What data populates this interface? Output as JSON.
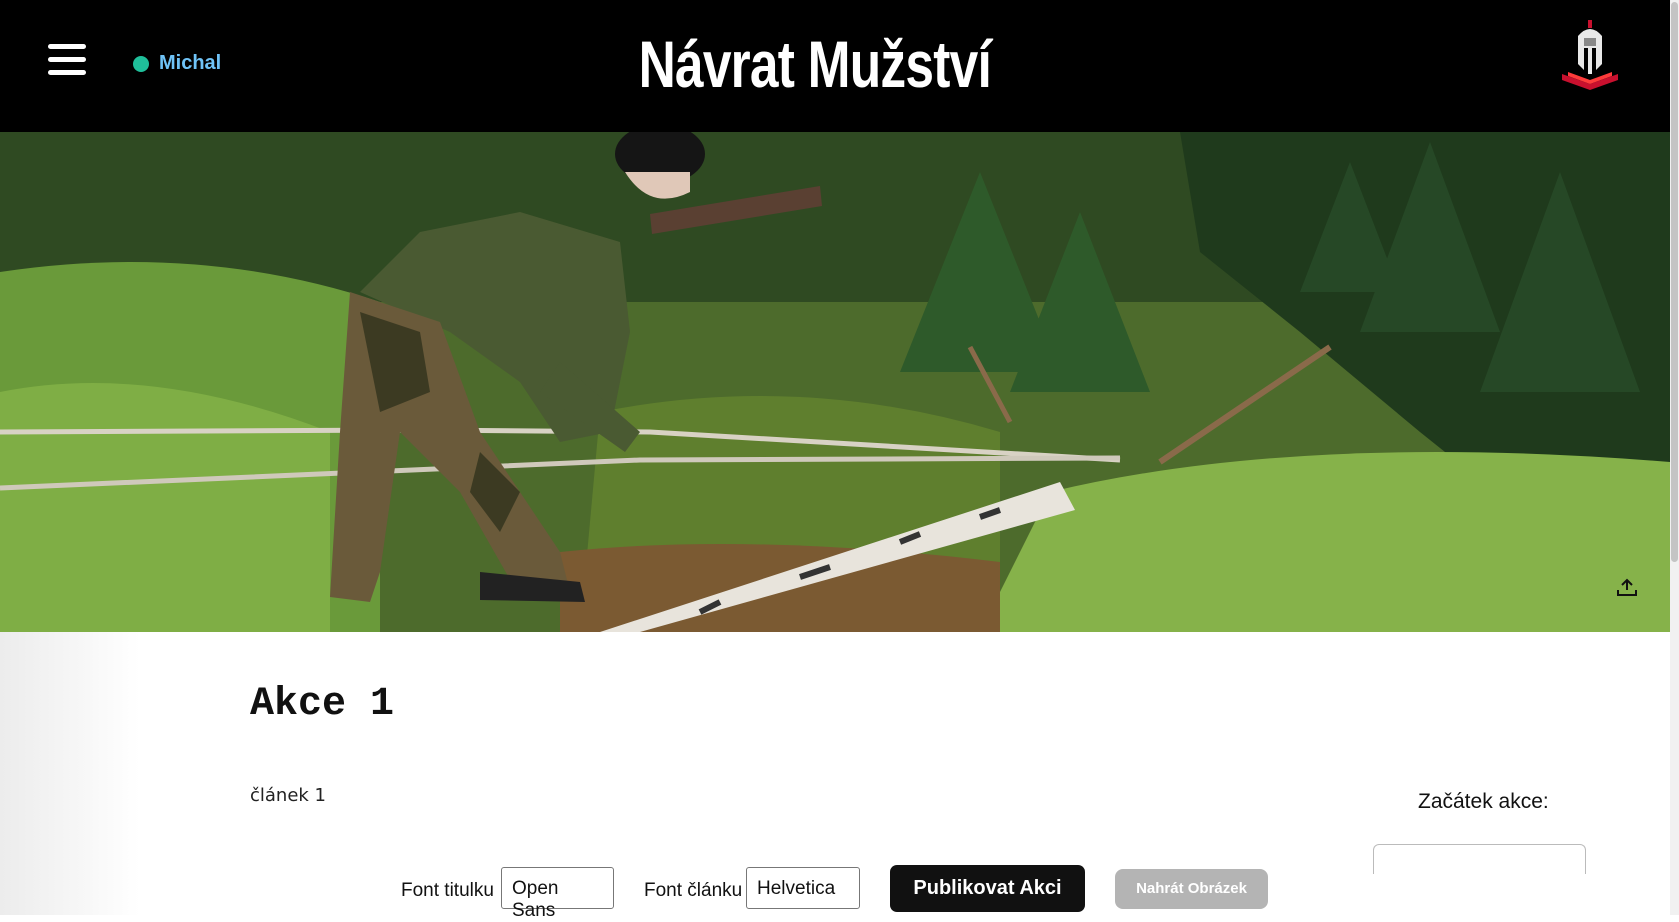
{
  "header": {
    "menu_icon": "hamburger-menu-icon",
    "user_name": "Michal",
    "status_color": "#1fbf9a",
    "site_title": "Návrat Mužství",
    "logo_icon": "spartan-helmet-logo"
  },
  "hero": {
    "image_subject": "man crossing rope bridge over birch log in forest",
    "upload_icon": "upload-icon"
  },
  "article": {
    "title": "Akce 1",
    "body": "článek 1"
  },
  "sidebar": {
    "start_label": "Začátek akce:"
  },
  "toolbar": {
    "title_font_label": "Font titulku",
    "title_font_value": "Open Sans",
    "article_font_label": "Font článku",
    "article_font_value": "Helvetica",
    "publish_label": "Publikovat Akci",
    "upload_label": "Nahrát Obrázek"
  },
  "colors": {
    "header_bg": "#000000",
    "user_name": "#6fc3f7",
    "publish_bg": "#111111",
    "upload_bg": "#b4b4b4",
    "logo_red": "#c8102e"
  }
}
